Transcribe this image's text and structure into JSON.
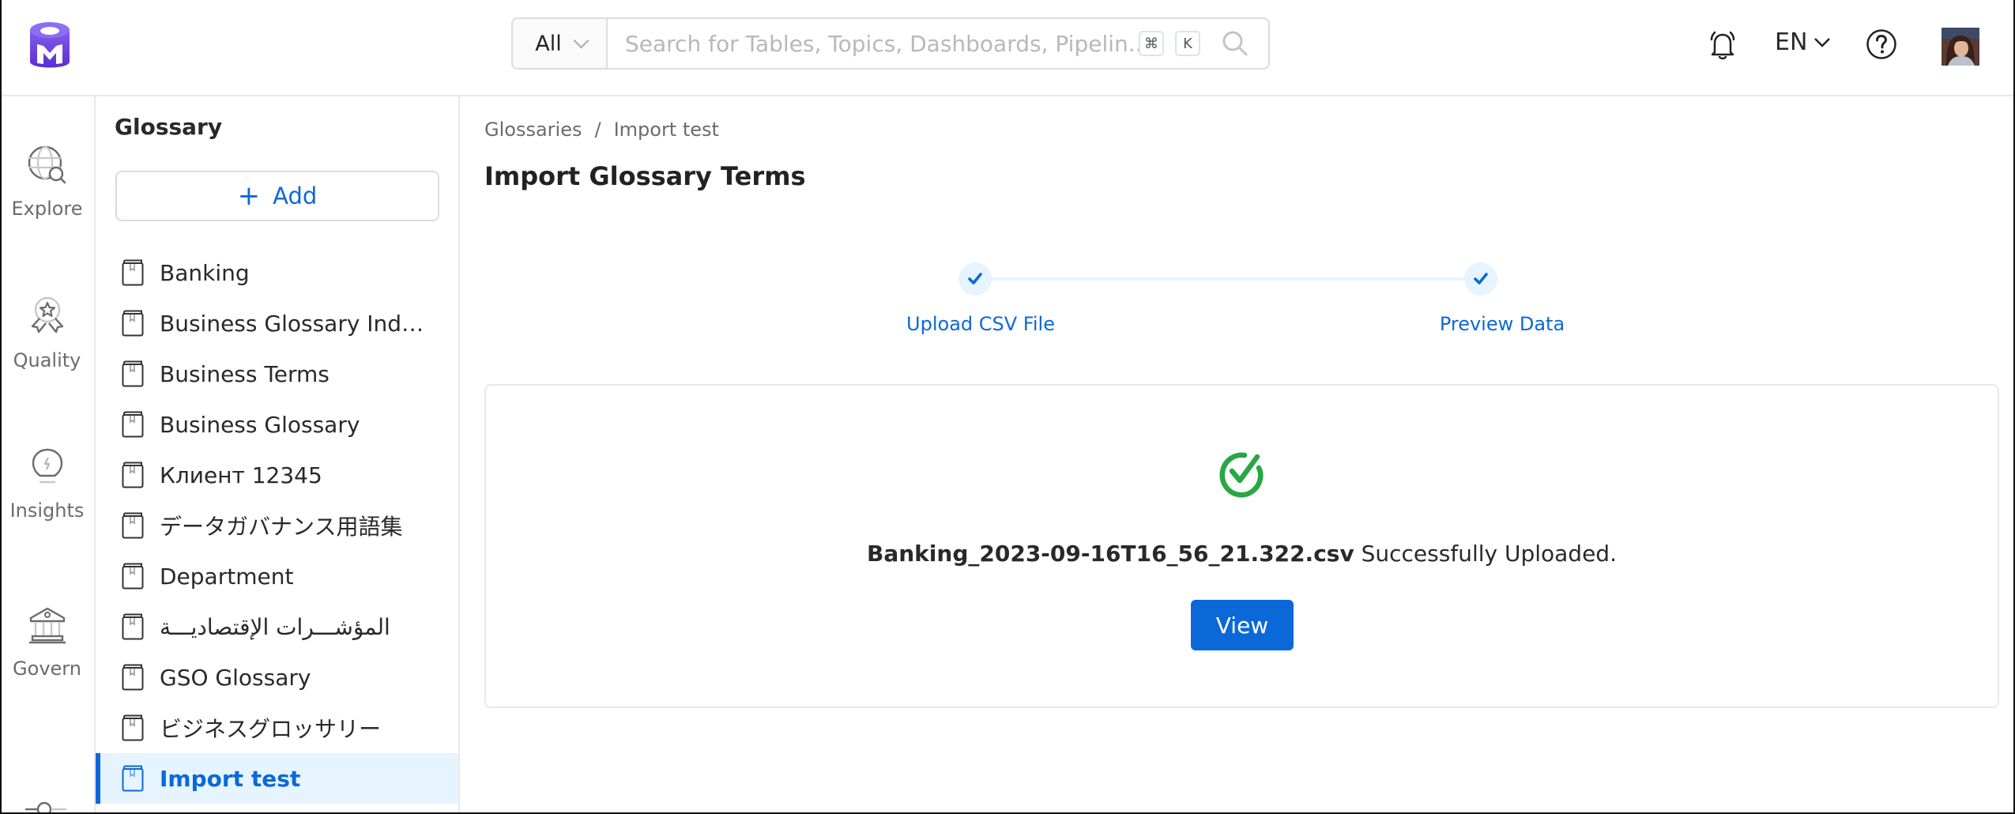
{
  "header": {
    "logo_icon": "openmetadata-logo",
    "search": {
      "category": "All",
      "placeholder": "Search for Tables, Topics, Dashboards, Pipelin...",
      "value": "",
      "shortcut_keys": [
        "⌘",
        "K"
      ]
    },
    "notifications_icon": "bell-icon",
    "language": "EN",
    "help_icon": "help-circle-icon",
    "avatar_icon": "user-avatar"
  },
  "leftnav": {
    "items": [
      {
        "label": "Explore",
        "icon": "globe-search-icon"
      },
      {
        "label": "Quality",
        "icon": "award-icon"
      },
      {
        "label": "Insights",
        "icon": "lightbulb-icon"
      },
      {
        "label": "Govern",
        "icon": "bank-icon"
      }
    ]
  },
  "glossary_panel": {
    "title": "Glossary",
    "add_label": "Add",
    "items": [
      {
        "label": "Banking",
        "active": false
      },
      {
        "label": "Business Glossary Indo...",
        "active": false
      },
      {
        "label": "Business Terms",
        "active": false
      },
      {
        "label": "Business Glossary",
        "active": false
      },
      {
        "label": "Клиент 12345",
        "active": false
      },
      {
        "label": "データガバナンス用語集",
        "active": false
      },
      {
        "label": "Department",
        "active": false
      },
      {
        "label": "المؤشـــرات الإقتصاديـــة",
        "active": false
      },
      {
        "label": "GSO Glossary",
        "active": false
      },
      {
        "label": "ビジネスグロッサリー",
        "active": false
      },
      {
        "label": "Import test",
        "active": true
      }
    ]
  },
  "main": {
    "breadcrumb": [
      "Glossaries",
      "Import test"
    ],
    "breadcrumb_separator": "/",
    "title": "Import Glossary Terms",
    "steps": [
      {
        "label": "Upload CSV File",
        "completed": true
      },
      {
        "label": "Preview Data",
        "completed": true
      }
    ],
    "result": {
      "file_name": "Banking_2023-09-16T16_56_21.322.csv",
      "message": "Successfully Uploaded.",
      "view_label": "View",
      "status_icon": "success-check-icon"
    }
  },
  "colors": {
    "primary": "#0b68d9",
    "success": "#28a745",
    "brand": "#7147e8",
    "selected_bg": "#e6f4ff"
  }
}
